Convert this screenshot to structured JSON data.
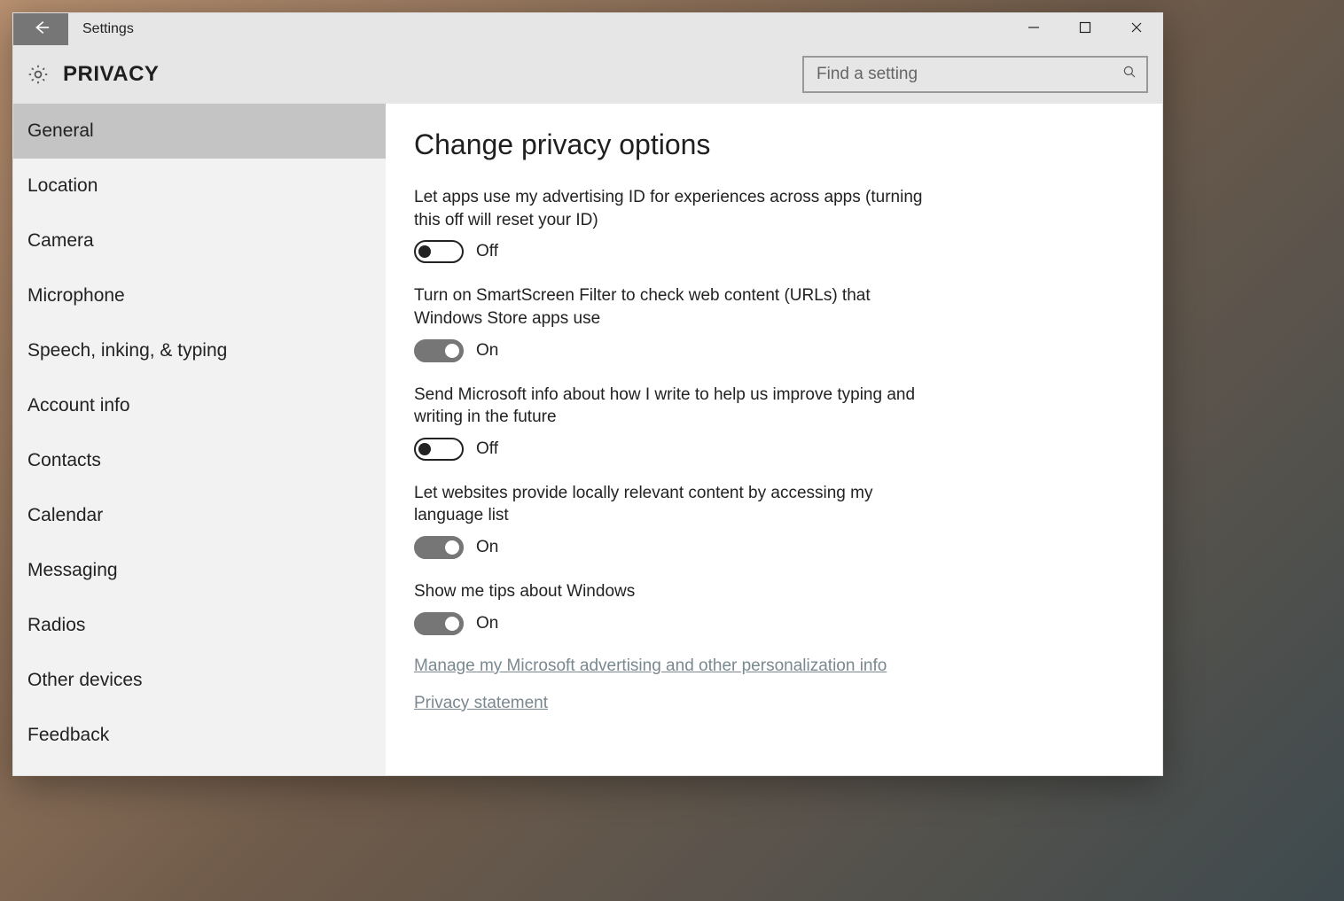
{
  "window": {
    "title": "Settings"
  },
  "header": {
    "section": "PRIVACY",
    "search_placeholder": "Find a setting"
  },
  "sidebar": {
    "items": [
      {
        "label": "General",
        "selected": true
      },
      {
        "label": "Location",
        "selected": false
      },
      {
        "label": "Camera",
        "selected": false
      },
      {
        "label": "Microphone",
        "selected": false
      },
      {
        "label": "Speech, inking, & typing",
        "selected": false
      },
      {
        "label": "Account info",
        "selected": false
      },
      {
        "label": "Contacts",
        "selected": false
      },
      {
        "label": "Calendar",
        "selected": false
      },
      {
        "label": "Messaging",
        "selected": false
      },
      {
        "label": "Radios",
        "selected": false
      },
      {
        "label": "Other devices",
        "selected": false
      },
      {
        "label": "Feedback",
        "selected": false
      }
    ]
  },
  "content": {
    "heading": "Change privacy options",
    "options": [
      {
        "label": "Let apps use my advertising ID for experiences across apps (turning this off will reset your ID)",
        "on": false,
        "state": "Off"
      },
      {
        "label": "Turn on SmartScreen Filter to check web content (URLs) that Windows Store apps use",
        "on": true,
        "state": "On"
      },
      {
        "label": "Send Microsoft info about how I write to help us improve typing and writing in the future",
        "on": false,
        "state": "Off"
      },
      {
        "label": "Let websites provide locally relevant content by accessing my language list",
        "on": true,
        "state": "On"
      },
      {
        "label": "Show me tips about Windows",
        "on": true,
        "state": "On"
      }
    ],
    "links": [
      "Manage my Microsoft advertising and other personalization info",
      "Privacy statement"
    ]
  }
}
